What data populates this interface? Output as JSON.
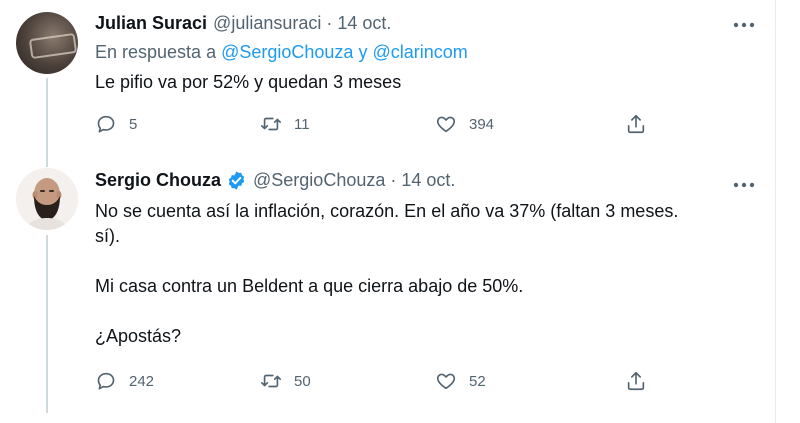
{
  "tweets": [
    {
      "name": "Julian Suraci",
      "handle": "@juliansuraci",
      "separator": "·",
      "date": "14 oct.",
      "reply_prefix": "En respuesta a",
      "reply_user1": "@SergioChouza",
      "reply_and": "y",
      "reply_user2": "@clarincom",
      "text": "Le pifio va por 52% y quedan 3 meses",
      "replies": "5",
      "retweets": "11",
      "likes": "394"
    },
    {
      "name": "Sergio Chouza",
      "verified": true,
      "handle": "@SergioChouza",
      "separator": "·",
      "date": "14 oct.",
      "text": "No se cuenta así la inflación, corazón. En el año va 37% (faltan 3 meses.\nsí).\n\nMi casa contra un Beldent a que cierra abajo de 50%.\n\n¿Apostás?",
      "replies": "242",
      "retweets": "50",
      "likes": "52"
    }
  ],
  "colors": {
    "text": "#0f1419",
    "secondary": "#536471",
    "link": "#1d9bf0",
    "verified": "#1d9bf0",
    "thread_line": "#cfd9de"
  },
  "icons": [
    "reply-icon",
    "retweet-icon",
    "like-icon",
    "share-icon",
    "more-icon",
    "verified-badge-icon"
  ]
}
